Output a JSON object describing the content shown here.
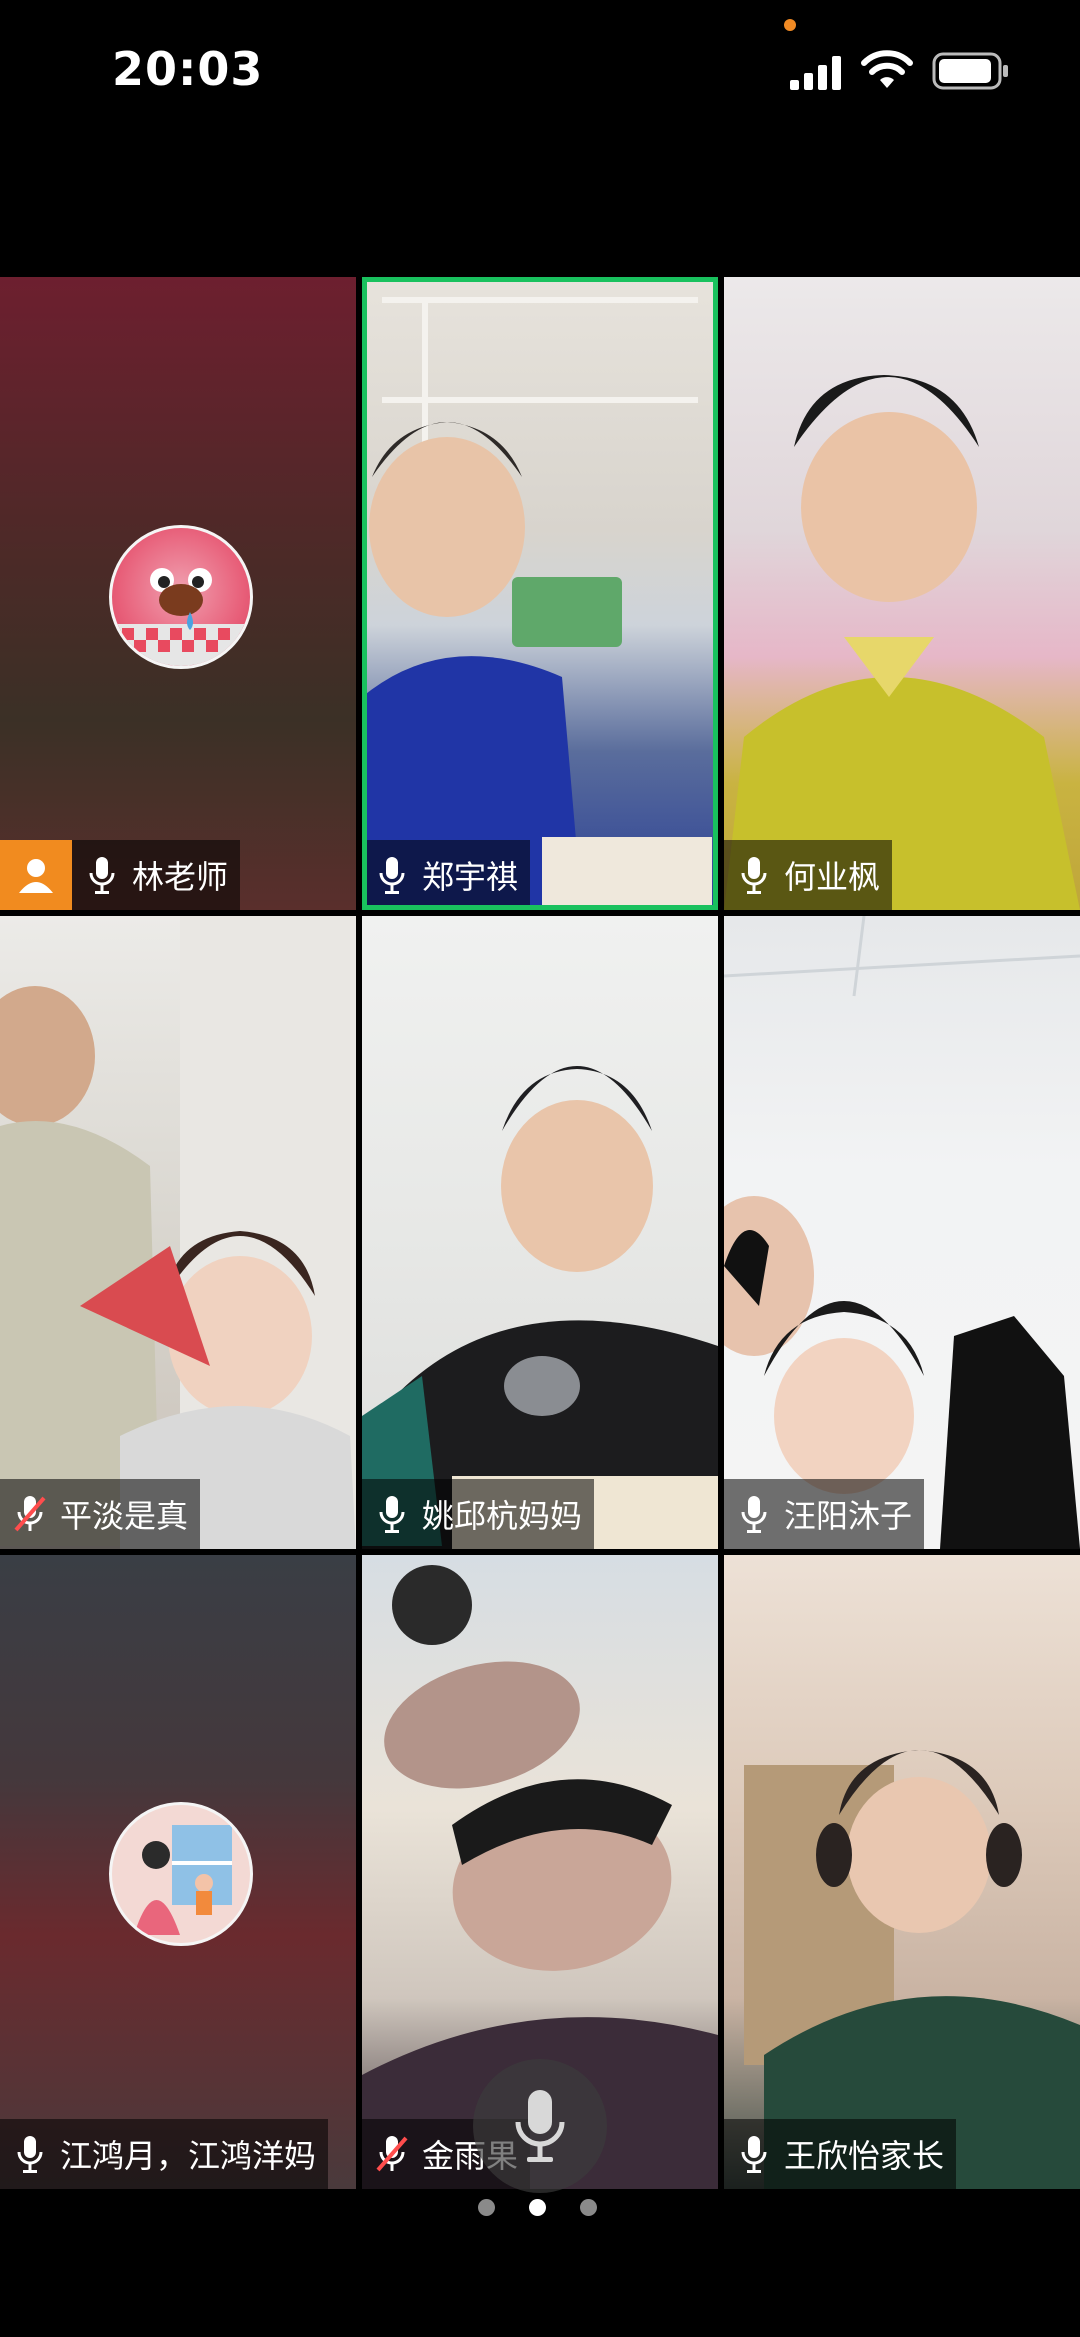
{
  "status_bar": {
    "time": "20:03"
  },
  "participants": [
    {
      "name": "林老师",
      "muted": false,
      "host": true
    },
    {
      "name": "郑宇祺",
      "muted": false,
      "speaking": true
    },
    {
      "name": "何业枫",
      "muted": false
    },
    {
      "name": "平淡是真",
      "muted": true
    },
    {
      "name": "姚邱杭妈妈",
      "muted": false
    },
    {
      "name": "汪阳沐子",
      "muted": false
    },
    {
      "name": "江鸿月，江鸿洋妈",
      "muted": false
    },
    {
      "name": "金雨果",
      "muted": true
    },
    {
      "name": "王欣怡家长",
      "muted": false
    }
  ],
  "pagination": {
    "total": 3,
    "current": 2
  },
  "colors": {
    "speaking_border": "#19c15e",
    "host_badge": "#f18b1f"
  }
}
